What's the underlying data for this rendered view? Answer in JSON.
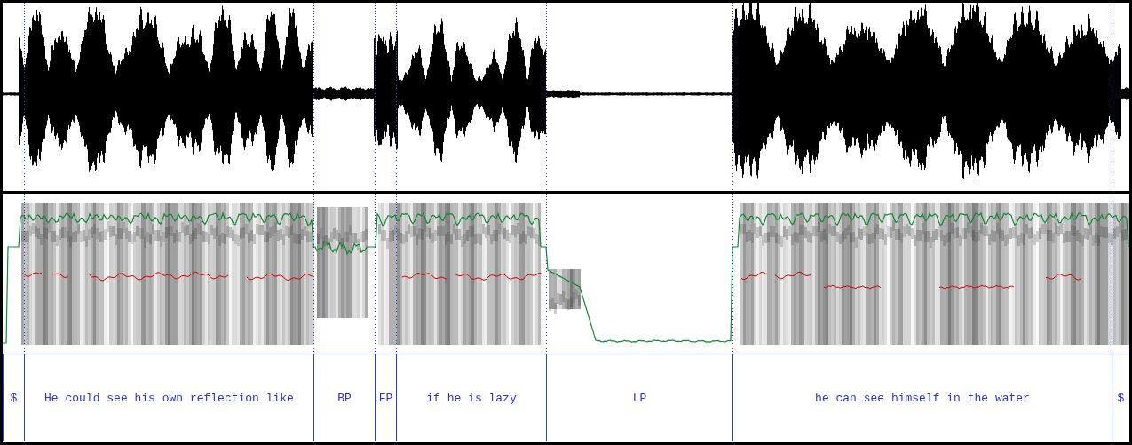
{
  "tier": {
    "intervals": [
      {
        "text": "$"
      },
      {
        "text": "He could see his own reflection like"
      },
      {
        "text": "BP"
      },
      {
        "text": "FP"
      },
      {
        "text": "if he is lazy"
      },
      {
        "text": "LP"
      },
      {
        "text": "he can see himself in the water"
      },
      {
        "text": "$"
      }
    ]
  }
}
